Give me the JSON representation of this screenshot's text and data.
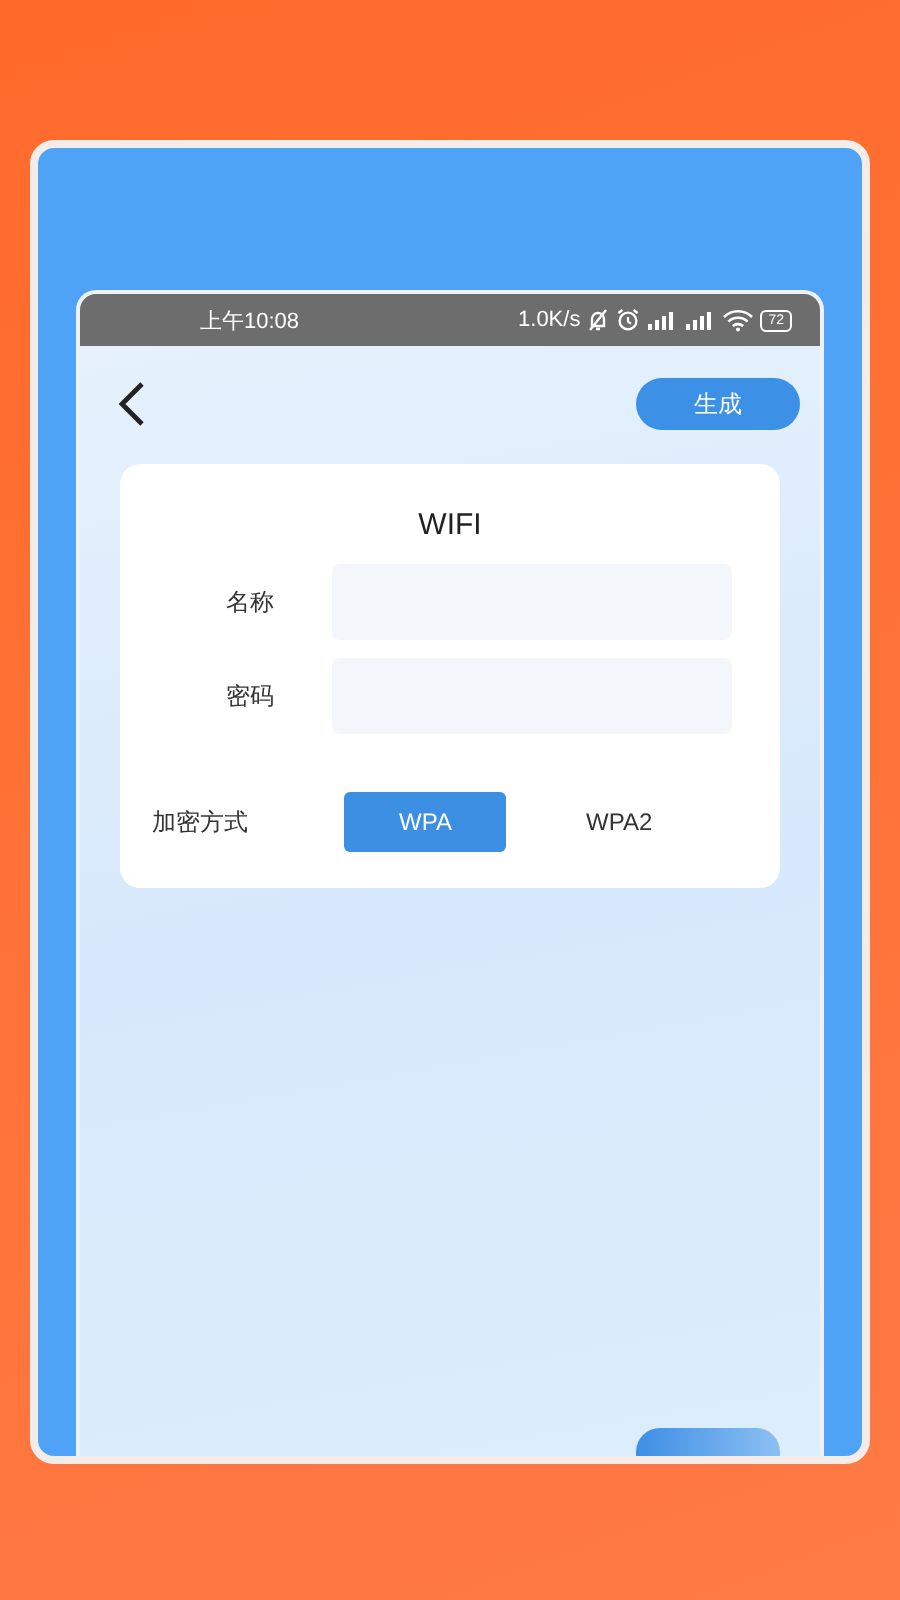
{
  "status_bar": {
    "time": "上午10:08",
    "speed": "1.0K/s",
    "battery": "72"
  },
  "header": {
    "action_button": "生成"
  },
  "form": {
    "title": "WIFI",
    "fields": [
      {
        "label": "名称"
      },
      {
        "label": "密码"
      }
    ],
    "encryption": {
      "label": "加密方式",
      "options": [
        {
          "label": "WPA",
          "selected": true
        },
        {
          "label": "WPA2",
          "selected": false
        }
      ]
    }
  }
}
